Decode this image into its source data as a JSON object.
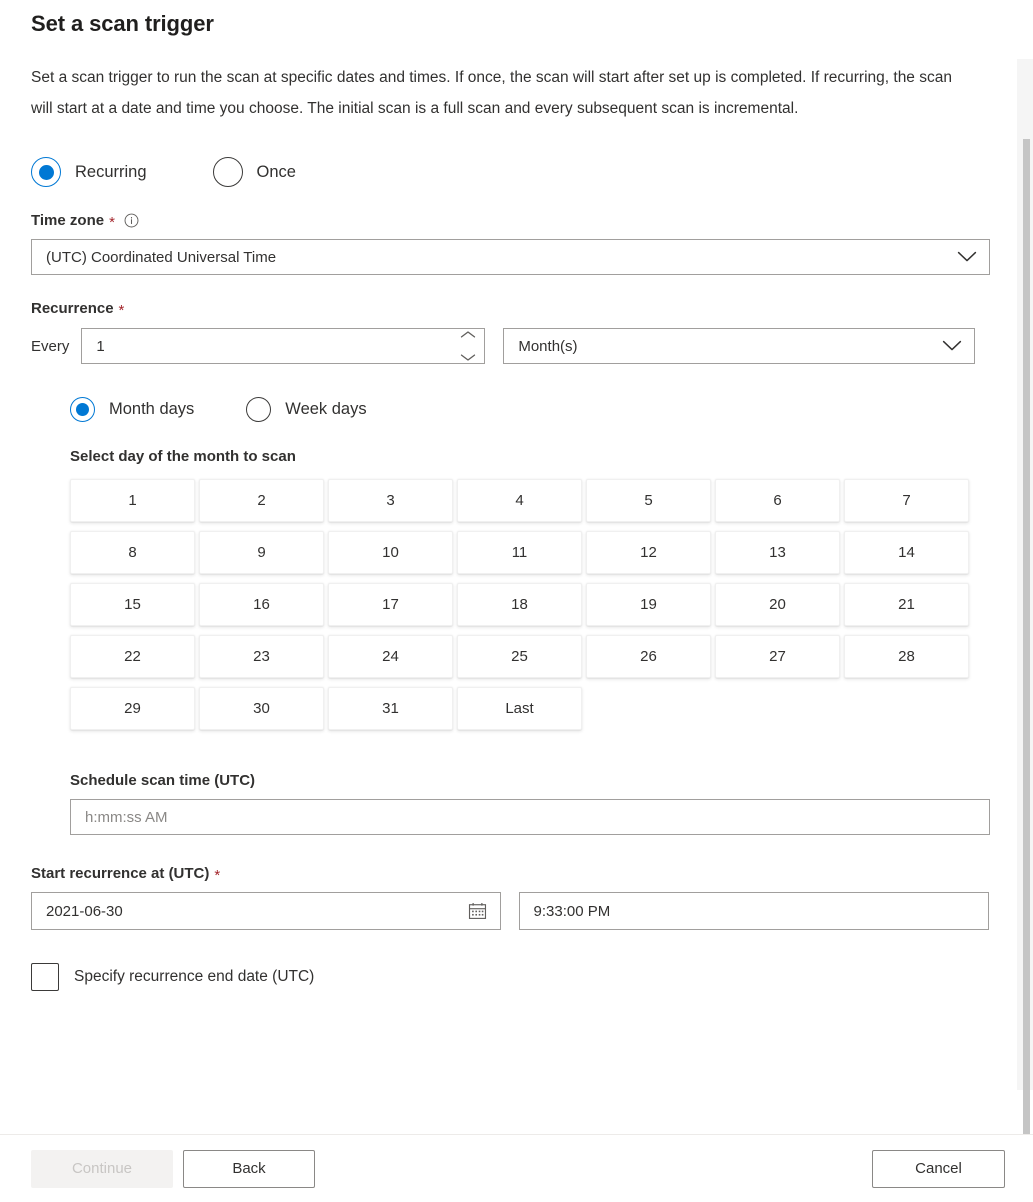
{
  "page": {
    "title": "Set a scan trigger",
    "description": "Set a scan trigger to run the scan at specific dates and times. If once, the scan will start after set up is completed. If recurring, the scan will start at a date and time you choose. The initial scan is a full scan and every subsequent scan is incremental."
  },
  "trigger_type": {
    "selected": "Recurring",
    "options": [
      {
        "label": "Recurring",
        "selected": true
      },
      {
        "label": "Once",
        "selected": false
      }
    ]
  },
  "time_zone": {
    "label": "Time zone",
    "required_marker": "*",
    "info_icon": "info-icon",
    "value": "(UTC) Coordinated Universal Time"
  },
  "recurrence": {
    "label": "Recurrence",
    "required_marker": "*",
    "every_label": "Every",
    "interval_value": "1",
    "unit_value": "Month(s)"
  },
  "day_mode": {
    "options": [
      {
        "label": "Month days",
        "selected": true
      },
      {
        "label": "Week days",
        "selected": false
      }
    ]
  },
  "month_days": {
    "label": "Select day of the month to scan",
    "cells": [
      "1",
      "2",
      "3",
      "4",
      "5",
      "6",
      "7",
      "8",
      "9",
      "10",
      "11",
      "12",
      "13",
      "14",
      "15",
      "16",
      "17",
      "18",
      "19",
      "20",
      "21",
      "22",
      "23",
      "24",
      "25",
      "26",
      "27",
      "28",
      "29",
      "30",
      "31",
      "Last"
    ]
  },
  "schedule_time": {
    "label": "Schedule scan time (UTC)",
    "value": "",
    "placeholder": "h:mm:ss AM"
  },
  "start_recurrence": {
    "label": "Start recurrence at (UTC)",
    "required_marker": "*",
    "date_value": "2021-06-30",
    "date_icon": "calendar-icon",
    "time_value": "9:33:00 PM"
  },
  "end_date": {
    "label": "Specify recurrence end date (UTC)",
    "checked": false
  },
  "footer": {
    "continue_label": "Continue",
    "back_label": "Back",
    "cancel_label": "Cancel"
  },
  "colors": {
    "accent": "#0078d4",
    "required": "#a4262c",
    "text": "#323130",
    "border": "#a19f9d"
  }
}
